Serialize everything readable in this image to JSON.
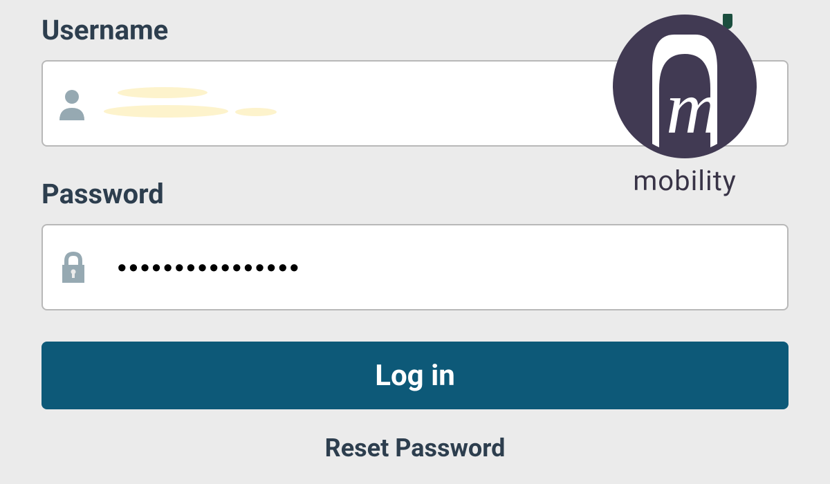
{
  "logo": {
    "text": "mobility",
    "icon_name": "mobility-logo-icon"
  },
  "form": {
    "username": {
      "label": "Username",
      "value": ""
    },
    "password": {
      "label": "Password",
      "masked_value": "••••••••••••••••"
    },
    "login_button_label": "Log in",
    "reset_password_label": "Reset Password"
  },
  "colors": {
    "primary_button": "#0d5978",
    "text": "#2d3e4e",
    "icon": "#96a9b2",
    "logo_dark": "#413a53",
    "logo_accent": "#1b4e3e"
  }
}
